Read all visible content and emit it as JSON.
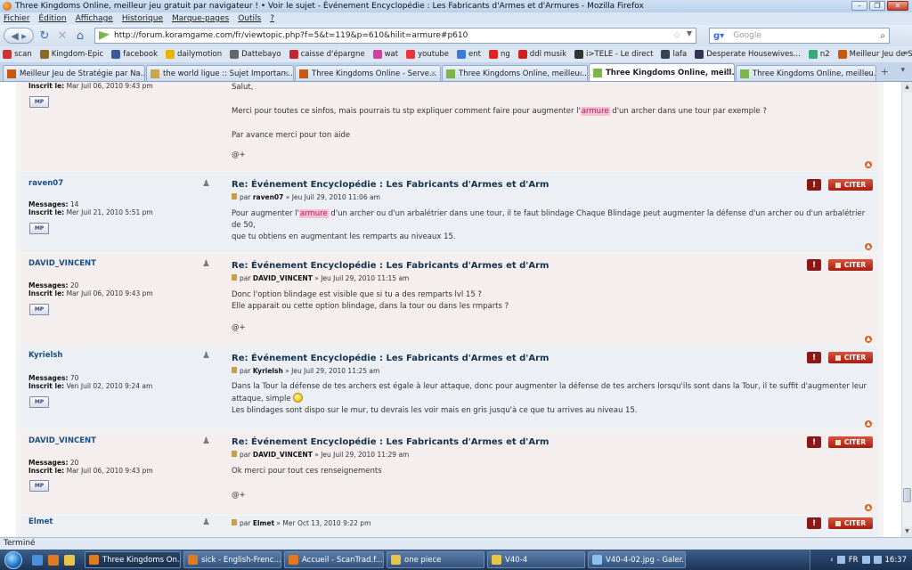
{
  "window": {
    "title": "Three Kingdoms Online, meilleur jeu gratuit par navigateur ! • Voir le sujet - Événement Encyclopédie : Les Fabricants d'Armes et d'Armures - Mozilla Firefox"
  },
  "menu": [
    "Fichier",
    "Édition",
    "Affichage",
    "Historique",
    "Marque-pages",
    "Outils",
    "?"
  ],
  "nav": {
    "url": "http://forum.koramgame.com/fr/viewtopic.php?f=5&t=119&p=610&hilit=armure#p610",
    "search_placeholder": "Google"
  },
  "bookmarks": [
    {
      "label": "scan",
      "color": "#c33"
    },
    {
      "label": "Kingdom-Epic",
      "color": "#8a6a2a"
    },
    {
      "label": "facebook",
      "color": "#3b5998"
    },
    {
      "label": "dailymotion",
      "color": "#e9b400"
    },
    {
      "label": "Dattebayo",
      "color": "#666"
    },
    {
      "label": "caisse d'épargne",
      "color": "#c0262d"
    },
    {
      "label": "wat",
      "color": "#d040a0"
    },
    {
      "label": "youtube",
      "color": "#e33"
    },
    {
      "label": "ent",
      "color": "#3a7ad8"
    },
    {
      "label": "ng",
      "color": "#d22"
    },
    {
      "label": "ddl musik",
      "color": "#c22"
    },
    {
      "label": "i>TELE - Le direct",
      "color": "#333"
    },
    {
      "label": "lafa",
      "color": "#345"
    },
    {
      "label": "Desperate Housewives...",
      "color": "#335"
    },
    {
      "label": "n2",
      "color": "#3a7"
    },
    {
      "label": "Meilleur Jeu de Stratég...",
      "color": "#c65a12"
    }
  ],
  "tabs": [
    {
      "label": "Meilleur Jeu de Stratégie par Na...",
      "color": "#c65a12",
      "active": false
    },
    {
      "label": "the world ligue :: Sujet Importan...",
      "color": "#c7a54a",
      "active": false
    },
    {
      "label": "Three Kingdoms Online - Serve...",
      "color": "#c65a12",
      "active": false
    },
    {
      "label": "Three Kingdoms Online, meilleu...",
      "color": "#7ab648",
      "active": false
    },
    {
      "label": "Three Kingdoms Online, meill...",
      "color": "#7ab648",
      "active": true
    },
    {
      "label": "Three Kingdoms Online, meilleu...",
      "color": "#7ab648",
      "active": false
    }
  ],
  "labels": {
    "messages": "Messages:",
    "registered": "Inscrit le:",
    "pm": "MP",
    "quote": "CITER",
    "warn": "!",
    "by": "par"
  },
  "posts": [
    {
      "registered": "Mar Juil 06, 2010 9:43 pm",
      "body": [
        "Salut,",
        "Merci pour toutes ce sinfos, mais pourrais tu stp expliquer comment faire pour augmenter l'armure d'un archer dans une tour par exemple ?",
        "Par avance merci pour ton aide"
      ],
      "sig": "@+"
    },
    {
      "author": "raven07",
      "messages": "14",
      "registered": "Mer Juil 21, 2010 5:51 pm",
      "title": "Re: Événement Encyclopédie : Les Fabricants d'Armes et d'Arm",
      "date": "Jeu Juil 29, 2010 11:06 am",
      "body": [
        "Pour augmenter l'armure d'un archer ou d'un arbalétrier dans une tour, il te faut blindage Chaque Blindage peut augmenter la défense d'un archer ou d'un arbalétrier de 50,",
        "que tu obtiens en augmentant les remparts au niveaux 15."
      ]
    },
    {
      "author": "DAVID_VINCENT",
      "messages": "20",
      "registered": "Mar Juil 06, 2010 9:43 pm",
      "title": "Re: Événement Encyclopédie : Les Fabricants d'Armes et d'Arm",
      "date": "Jeu Juil 29, 2010 11:15 am",
      "body": [
        "Donc l'option blindage est visible que si tu a des remparts lvl 15 ?",
        "Elle apparait ou cette option blindage, dans la tour ou dans les rmparts ?"
      ],
      "sig": "@+"
    },
    {
      "author": "Kyrielsh",
      "messages": "70",
      "registered": "Ven Juil 02, 2010 9:24 am",
      "title": "Re: Événement Encyclopédie : Les Fabricants d'Armes et d'Arm",
      "date": "Jeu Juil 29, 2010 11:25 am",
      "body": [
        "Dans la Tour la défense de tes archers est égale à leur attaque, donc pour augmenter la défense de tes archers lorsqu'ils sont dans la Tour, il te suffit d'augmenter leur",
        "attaque, simple",
        "Les blindages sont dispo sur le mur, tu devrais les voir mais en gris jusqu'à ce que tu arrives au niveau 15."
      ]
    },
    {
      "author": "DAVID_VINCENT",
      "messages": "20",
      "registered": "Mar Juil 06, 2010 9:43 pm",
      "title": "Re: Événement Encyclopédie : Les Fabricants d'Armes et d'Arm",
      "date": "Jeu Juil 29, 2010 11:29 am",
      "body": [
        "Ok merci pour tout ces renseignements"
      ],
      "sig": "@+"
    },
    {
      "author": "Elmet",
      "date": "Mer Oct 13, 2010 9:22 pm"
    }
  ],
  "status": "Terminé",
  "taskbar": {
    "items": [
      {
        "label": "Three Kingdoms On...",
        "color": "#e07a20",
        "active": true
      },
      {
        "label": "sick - English-Frenc...",
        "color": "#e07a20",
        "active": false
      },
      {
        "label": "Accueil - ScanTrad.f...",
        "color": "#e07a20",
        "active": false
      },
      {
        "label": "one piece",
        "color": "#e8c44a",
        "active": false
      },
      {
        "label": "V40-4",
        "color": "#e8c44a",
        "active": false
      },
      {
        "label": "V40-4-02.jpg - Galer...",
        "color": "#8bc1ee",
        "active": false
      }
    ],
    "clock": "16:37",
    "lang": "FR"
  }
}
